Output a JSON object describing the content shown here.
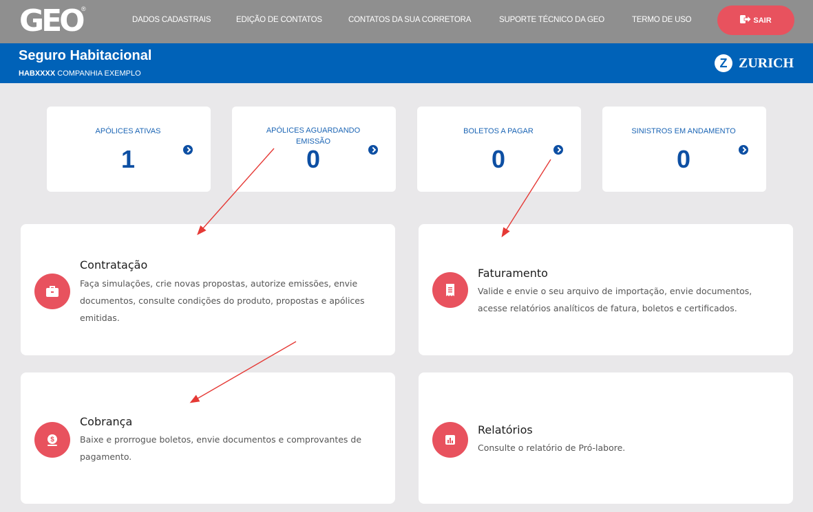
{
  "header": {
    "logo": "GEO",
    "logo_reg": "®",
    "nav": [
      {
        "label": "DADOS CADASTRAIS"
      },
      {
        "label": "EDIÇÃO DE CONTATOS"
      },
      {
        "label": "CONTATOS DA SUA CORRETORA"
      },
      {
        "label": "SUPORTE TÉCNICO DA GEO"
      },
      {
        "label": "TERMO DE USO"
      }
    ],
    "logout_label": "SAIR"
  },
  "product": {
    "title": "Seguro Habitacional",
    "code": "HABXXXX",
    "company": "COMPANHIA EXEMPLO",
    "brand": "ZURICH",
    "brand_mark": "Z"
  },
  "stats": [
    {
      "title": "APÓLICES ATIVAS",
      "value": "1"
    },
    {
      "title": "APÓLICES AGUARDANDO EMISSÃO",
      "value": "0"
    },
    {
      "title": "BOLETOS A PAGAR",
      "value": "0"
    },
    {
      "title": "SINISTROS EM ANDAMENTO",
      "value": "0"
    }
  ],
  "cards": [
    {
      "title": "Contratação",
      "icon": "briefcase-icon",
      "description": "Faça simulações, crie novas propostas, autorize emissões, envie documentos, consulte condições do produto, propostas e apólices emitidas."
    },
    {
      "title": "Faturamento",
      "icon": "receipt-icon",
      "description": "Valide e envie o seu arquivo de importação, envie documentos, acesse relatórios analíticos de fatura, boletos e certificados."
    },
    {
      "title": "Cobrança",
      "icon": "money-bag-icon",
      "description": "Baixe e prorrogue boletos, envie documentos e comprovantes de pagamento."
    },
    {
      "title": "Relatórios",
      "icon": "bar-chart-icon",
      "description": "Consulte o relatório de Pró-labore."
    }
  ],
  "colors": {
    "topbar": "#8f8f8f",
    "brand_blue": "#0062b8",
    "accent_red": "#e8525e",
    "stat_blue": "#0d4fa3",
    "annotation_arrow": "#e53935"
  }
}
